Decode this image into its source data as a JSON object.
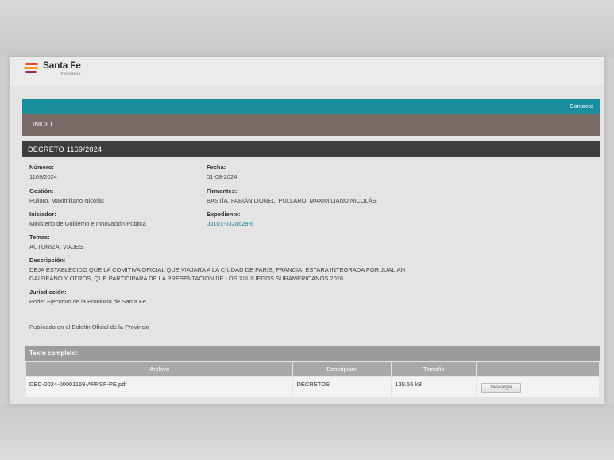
{
  "brand": {
    "name": "Santa Fe",
    "subtitle": "PROVINCIA",
    "colors": [
      "#e94a26",
      "#f39a1d",
      "#8a2b6d"
    ]
  },
  "topbar": {
    "contact": "Contacto"
  },
  "nav": {
    "home": "INICIO"
  },
  "decree": {
    "title": "DECRETO 1169/2024",
    "numero_label": "Número:",
    "numero": "1169/2024",
    "fecha_label": "Fecha:",
    "fecha": "01-08-2024",
    "gestion_label": "Gestión:",
    "gestion": "Pullaro, Maximiliano Nicolás",
    "firmantes_label": "Firmantes:",
    "firmantes": "BASTÍA, FABIÁN LIONEL; PULLARO, MAXIMILIANO NICOLÁS",
    "iniciador_label": "Iniciador:",
    "iniciador": "Ministerio de Gobierno e Innovación Pública",
    "expediente_label": "Expediente:",
    "expediente": "00101-0328629-6",
    "temas_label": "Temas:",
    "temas": "AUTORIZA; VIAJES",
    "descripcion_label": "Descripción:",
    "descripcion_1": "DEJA ESTABLECIDO QUE LA COMITIVA OFICIAL QUE VIAJARA A LA CIUDAD DE PARIS, FRANCIA, ESTARA INTEGRADA POR JUALIAN",
    "descripcion_2": "GALDEANO Y OTROS, QUE PARTICIPARA DE LA PRESENTACION DE LOS XIII JUEGOS SURAMERICANOS 2026",
    "jurisdiccion_label": "Jurisdicción:",
    "jurisdiccion": "Poder Ejecutivo de la Provincia de Santa Fe",
    "publicado": "Publicado en el Boletín Oficial de la Provincia"
  },
  "texto_completo": {
    "title": "Texto completo:",
    "headers": [
      "Archivo",
      "Descripción",
      "Tamaño",
      ""
    ],
    "rows": [
      {
        "archivo": "DEC-2024-00001169-APPSF-PE.pdf",
        "descripcion": "DECRETOS",
        "tamano": "139.56 kB",
        "action": "Descargar"
      }
    ]
  }
}
